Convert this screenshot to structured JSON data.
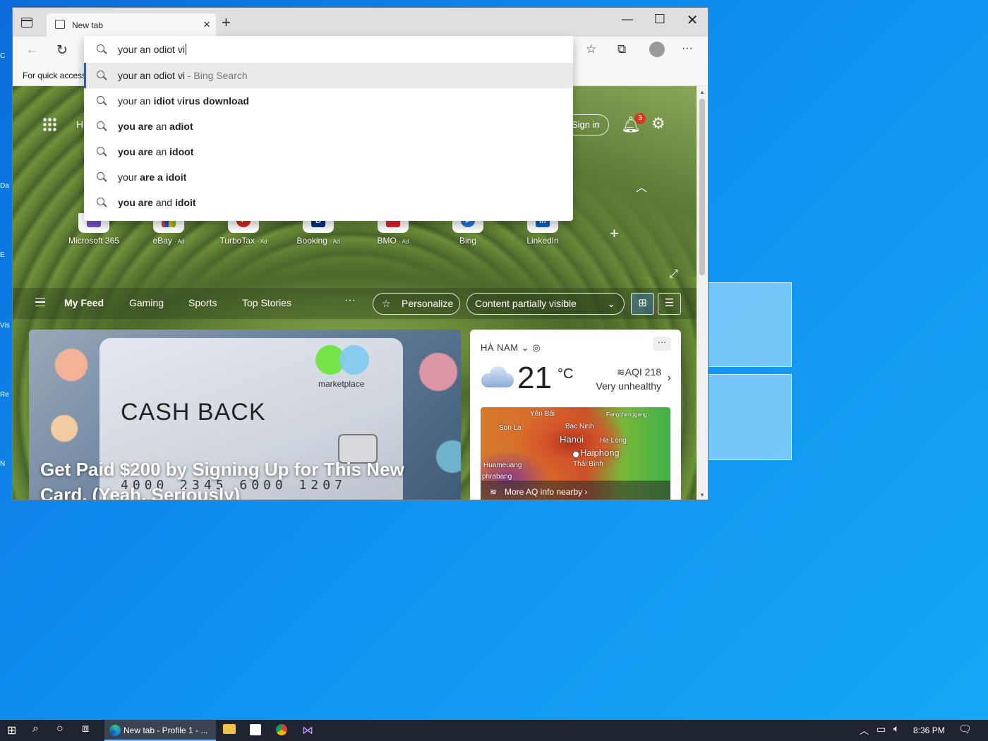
{
  "browser": {
    "tab_title": "New tab",
    "favorites_bar_text": "For quick access"
  },
  "omnibox": {
    "query": "your an odiot vi",
    "suggestions": [
      {
        "pre": "your an odiot vi",
        "bold": "",
        "post": "",
        "sub": " - Bing Search"
      },
      {
        "pre": "your an ",
        "bold": "idiot",
        "post": " v",
        "bold2": "irus download"
      },
      {
        "pre": "",
        "bold": "you are",
        "post": " an ",
        "bold2": "adiot"
      },
      {
        "pre": "",
        "bold": "you are",
        "post": " an ",
        "bold2": "idoot"
      },
      {
        "pre": "your ",
        "bold": "are a",
        "post": " ",
        "bold2": "idoit"
      },
      {
        "pre": "",
        "bold": "you are",
        "post": " and ",
        "bold2": "idoit"
      }
    ]
  },
  "ntp": {
    "header_partial": "H",
    "sign_in": "Sign in",
    "notification_count": "3",
    "quick_links": [
      {
        "label": "Microsoft 365",
        "ad": "",
        "color": "#7b4fc9"
      },
      {
        "label": "eBay",
        "ad": "· Ad",
        "color": "#e53238"
      },
      {
        "label": "TurboTax",
        "ad": "· Ad",
        "color": "#d52b1e"
      },
      {
        "label": "Booking",
        "ad": "· Ad",
        "color": "#003580"
      },
      {
        "label": "BMO",
        "ad": "· Ad",
        "color": "#0079c1"
      },
      {
        "label": "Bing",
        "ad": "",
        "color": "#1e7be0"
      },
      {
        "label": "LinkedIn",
        "ad": "",
        "color": "#0a66c2"
      }
    ],
    "feed_tabs": [
      "My Feed",
      "Gaming",
      "Sports",
      "Top Stories"
    ],
    "more": "···",
    "personalize": "Personalize",
    "content_visibility": "Content partially visible",
    "hero": {
      "brand": "marketplace",
      "card_text": "CASH BACK",
      "card_number": "4000 2345 6000 1207",
      "title": "Get Paid $200 by Signing Up for This New Card. (Yeah, Seriously)"
    },
    "weather": {
      "location": "HÀ NAM",
      "temperature": "21",
      "unit": "°C",
      "aqi": "AQI 218",
      "aqi_desc": "Very unhealthy",
      "map_labels": [
        "Yên Bái",
        "Fangchenggang",
        "Son La",
        "Bac Ninh",
        "Hanoi",
        "Ha Long",
        "Haiphong",
        "Thái Bình",
        "Huameuang",
        "phrabang"
      ],
      "more_aq": "More AQ info nearby"
    }
  },
  "taskbar": {
    "app_label": "New tab - Profile 1 - ...",
    "clock": "8:36 PM"
  },
  "desktop": {
    "icon_fragments": [
      "C",
      "Da",
      "E",
      "Vis",
      "Re",
      "N"
    ]
  }
}
